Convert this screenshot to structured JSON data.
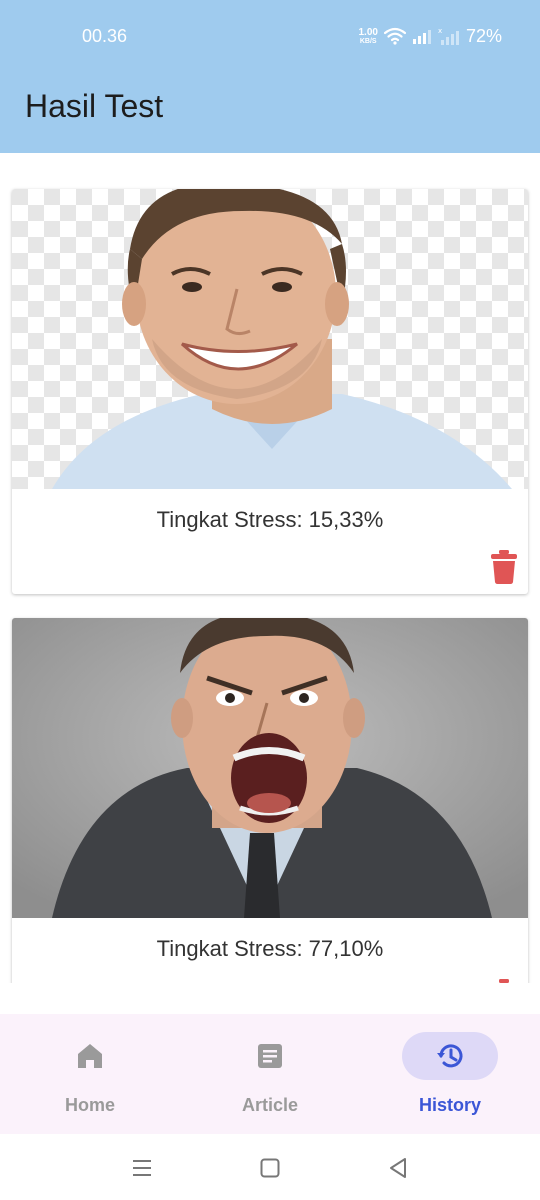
{
  "status_bar": {
    "time": "00.36",
    "net_speed_value": "1.00",
    "net_speed_unit": "KB/S",
    "battery": "72%",
    "icons": [
      "wifi-icon",
      "signal-icon",
      "signal-icon",
      "battery-text"
    ]
  },
  "header": {
    "title": "Hasil Test"
  },
  "results": [
    {
      "label": "Tingkat Stress: 15,33%",
      "photo": "smiling-man-photo"
    },
    {
      "label": "Tingkat Stress: 77,10%",
      "photo": "shouting-man-photo"
    }
  ],
  "bottom_nav": {
    "items": [
      {
        "label": "Home",
        "icon": "home-icon",
        "active": false
      },
      {
        "label": "Article",
        "icon": "article-icon",
        "active": false
      },
      {
        "label": "History",
        "icon": "history-icon",
        "active": true
      }
    ]
  },
  "colors": {
    "header": "#9fcbee",
    "delete": "#e05555",
    "nav_active": "#3b56d6",
    "nav_pill": "#ded9f7",
    "nav_bg": "#fbf2fb"
  }
}
